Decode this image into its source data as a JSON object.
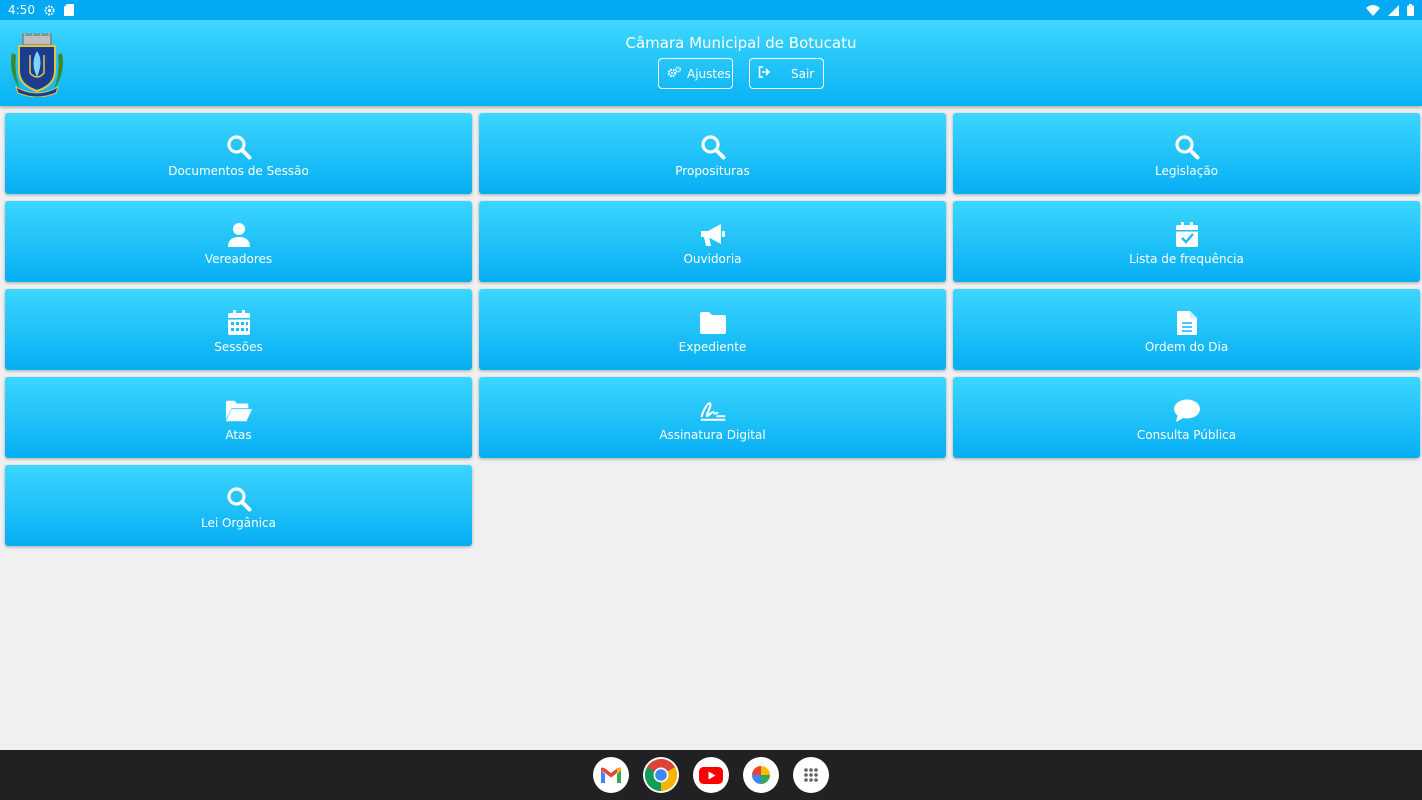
{
  "status": {
    "time": "4:50"
  },
  "header": {
    "title": "Câmara Municipal de Botucatu",
    "settings_label": "Ajustes",
    "logout_label": "Sair"
  },
  "tiles": [
    {
      "label": "Documentos de Sessão",
      "icon": "search-icon"
    },
    {
      "label": "Proposituras",
      "icon": "search-icon"
    },
    {
      "label": "Legislação",
      "icon": "search-icon"
    },
    {
      "label": "Vereadores",
      "icon": "user-icon"
    },
    {
      "label": "Ouvidoria",
      "icon": "megaphone-icon"
    },
    {
      "label": "Lista de frequência",
      "icon": "calendar-check-icon"
    },
    {
      "label": "Sessões",
      "icon": "calendar-icon"
    },
    {
      "label": "Expediente",
      "icon": "folder-icon"
    },
    {
      "label": "Ordem do Dia",
      "icon": "document-icon"
    },
    {
      "label": "Atas",
      "icon": "folder-open-icon"
    },
    {
      "label": "Assinatura Digital",
      "icon": "signature-icon"
    },
    {
      "label": "Consulta Pública",
      "icon": "comment-icon"
    },
    {
      "label": "Lei Orgânica",
      "icon": "search-icon"
    }
  ],
  "dock": [
    "gmail-icon",
    "chrome-icon",
    "youtube-icon",
    "photos-icon",
    "app-drawer-icon"
  ],
  "colors": {
    "accent": "#03a9f4",
    "tile_top": "#3cd6ff",
    "tile_bottom": "#06aef2",
    "navbar": "#212124"
  }
}
